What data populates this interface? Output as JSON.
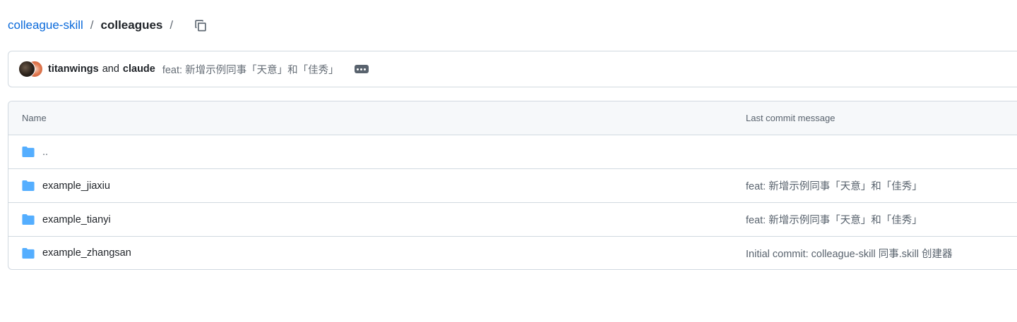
{
  "breadcrumb": {
    "repo": "colleague-skill",
    "separator": "/",
    "current": "colleagues",
    "trailing_separator": "/",
    "copy_icon": "copy-icon"
  },
  "commit": {
    "author_1": "titanwings",
    "and": "and",
    "author_2": "claude",
    "message": "feat: 新增示例同事「天意」和「佳秀」",
    "more_icon": "ellipsis-icon"
  },
  "table": {
    "headers": {
      "name": "Name",
      "last_commit": "Last commit message"
    },
    "rows": [
      {
        "name": "..",
        "message": "",
        "icon": "folder-icon"
      },
      {
        "name": "example_jiaxiu",
        "message": "feat: 新增示例同事「天意」和「佳秀」",
        "icon": "folder-icon"
      },
      {
        "name": "example_tianyi",
        "message": "feat: 新增示例同事「天意」和「佳秀」",
        "icon": "folder-icon"
      },
      {
        "name": "example_zhangsan",
        "message": "Initial commit: colleague-skill 同事.skill 创建器",
        "icon": "folder-icon"
      }
    ]
  },
  "colors": {
    "link": "#0969da",
    "folder": "#54aeff",
    "border": "#d1d9e0",
    "muted": "#59636e"
  }
}
